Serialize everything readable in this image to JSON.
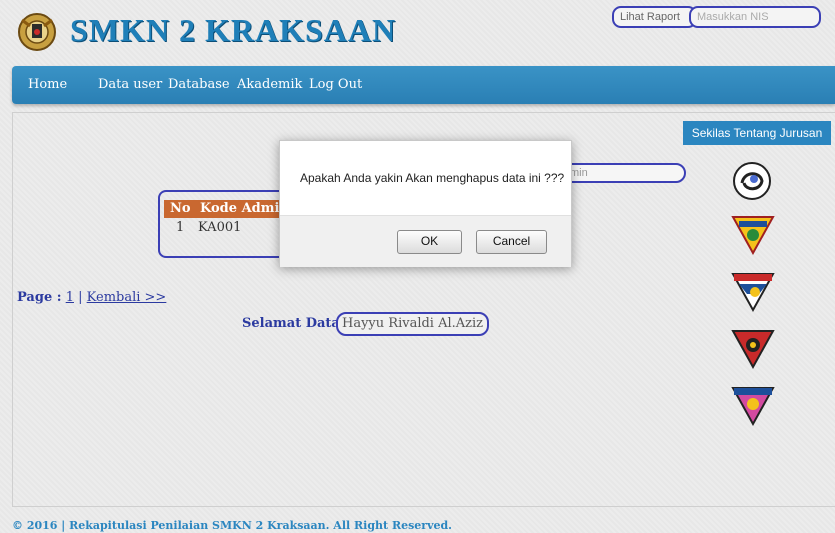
{
  "header": {
    "site_title": "SMKN 2 KRAKSAAN",
    "report_button": "Lihat Raport",
    "nis_placeholder": "Masukkan NIS"
  },
  "nav": {
    "items": [
      "Home",
      "Data user",
      "Database",
      "Akademik",
      "Log Out"
    ]
  },
  "sidebar": {
    "title": "Sekilas Tentang Jurusan",
    "badges": [
      "emblem-1",
      "emblem-2",
      "emblem-3",
      "emblem-4",
      "emblem-5"
    ]
  },
  "main": {
    "search_partial": "min",
    "table": {
      "headers": [
        "No",
        "Kode Admin"
      ],
      "rows": [
        [
          "1",
          "KA001"
        ]
      ]
    },
    "pagination": {
      "label": "Page :",
      "page": "1",
      "separator": "|",
      "back": "Kembali >>"
    },
    "welcome_label": "Selamat Datang",
    "user_name": "Hayyu Rivaldi Al.Aziz"
  },
  "footer": {
    "text": "© 2016 | Rekapitulasi Penilaian SMKN 2 Kraksaan. All Right Reserved."
  },
  "dialog": {
    "message": "Apakah Anda yakin Akan menghapus data ini ???",
    "ok": "OK",
    "cancel": "Cancel"
  },
  "colors": {
    "brand": "#1f7fb8",
    "nav": "#2a7fb4",
    "link": "#2b3aa0",
    "table_header": "#c96830"
  }
}
